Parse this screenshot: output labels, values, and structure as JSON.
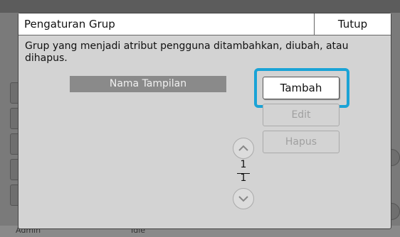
{
  "dialog": {
    "title": "Pengaturan Grup",
    "close_label": "Tutup",
    "message": "Grup yang menjadi atribut pengguna ditambahkan, diubah, atau dihapus.",
    "column_header": "Nama Tampilan",
    "buttons": {
      "add_label": "Tambah",
      "edit_label": "Edit",
      "delete_label": "Hapus"
    },
    "pagination": {
      "current": "1",
      "total": "1"
    }
  },
  "background": {
    "user_label": "Admin",
    "status_label": "Idle"
  },
  "colors": {
    "highlight": "#1aa3d6",
    "dialog_bg": "#d3d3d3",
    "header_bg": "#8a8a8a"
  }
}
